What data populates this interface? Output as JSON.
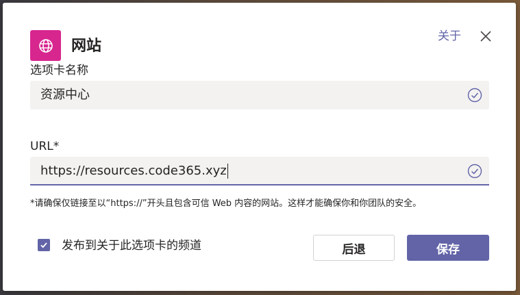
{
  "dialog": {
    "app_icon": "globe-icon",
    "title": "网站",
    "about_link": "关于",
    "close_icon": "close-icon"
  },
  "tab_name": {
    "label": "选项卡名称",
    "value": "资源中心",
    "status_icon": "check-circle-icon"
  },
  "url": {
    "label": "URL*",
    "value": "https://resources.code365.xyz",
    "status_icon": "check-circle-icon"
  },
  "help_text": "*请确保仅链接至以“https://”开头且包含可信 Web 内容的网站。这样才能确保你和你团队的安全。",
  "post_option": {
    "checked": true,
    "label": "发布到关于此选项卡的频道"
  },
  "buttons": {
    "back": "后退",
    "save": "保存"
  },
  "colors": {
    "accent": "#6264a7",
    "app_icon_bg": "#d8268f"
  }
}
